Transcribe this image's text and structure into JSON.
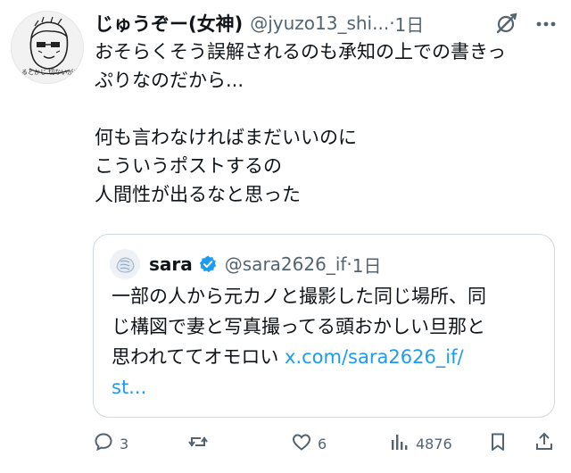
{
  "post": {
    "author_name": "じゅうぞー(女神)",
    "author_handle": "@jyuzo13_shi...",
    "time_separator": "·",
    "time": "1日",
    "avatar_text": "ふるとかじ 切ないがひ",
    "lines": [
      "おそらくそう誤解されるのも承知の上での書きっ",
      "ぷりなのだから...",
      "",
      "何も言わなければまだいいのに",
      "こういうポストするの",
      "人間性が出るなと思った"
    ]
  },
  "quote": {
    "name": "sara",
    "verified": true,
    "handle": "@sara2626_if",
    "time_separator": "·",
    "time": "1日",
    "lines": [
      "一部の人から元カノと撮影した同じ場所、同",
      "じ構図で妻と写真撮ってる頭おかしい旦那と"
    ],
    "line3_text": "思われててオモロい",
    "link_part1": "x.com/sara2626_if/",
    "link_part2": "st..."
  },
  "actions": {
    "reply_count": "3",
    "repost_count": "",
    "like_count": "6",
    "views_count": "4876"
  },
  "colors": {
    "text": "#0f1419",
    "secondary": "#536471",
    "link": "#1d9bf0",
    "border": "#cfd9de"
  }
}
